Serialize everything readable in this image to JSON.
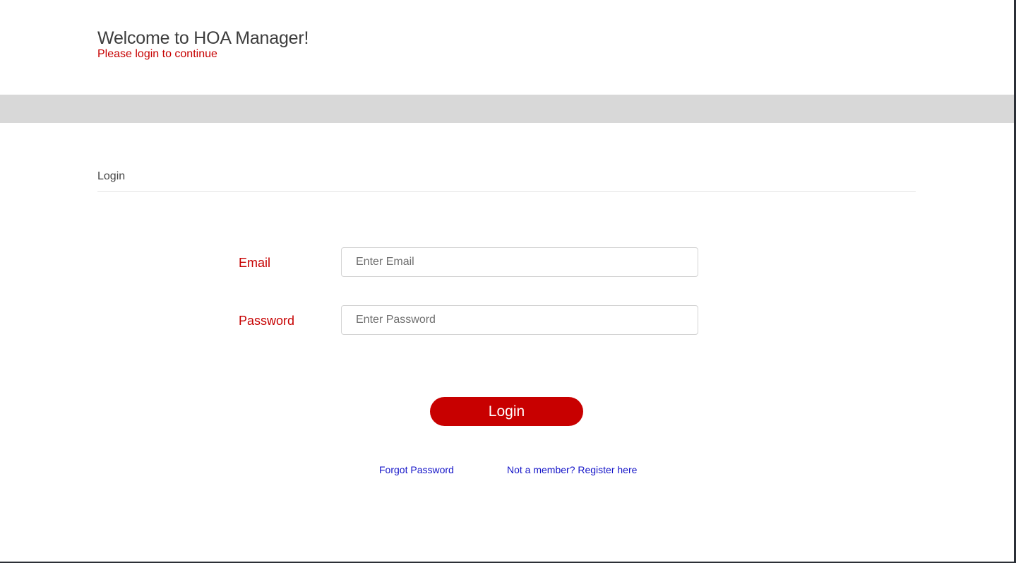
{
  "header": {
    "title": "Welcome to HOA Manager!",
    "subtitle": "Please login to continue"
  },
  "section": {
    "title": "Login"
  },
  "form": {
    "email_label": "Email",
    "email_placeholder": "Enter Email",
    "email_value": "",
    "password_label": "Password",
    "password_placeholder": "Enter Password",
    "password_value": "",
    "login_label": "Login"
  },
  "links": {
    "forgot_password": "Forgot Password",
    "register": "Not a member? Register here"
  },
  "colors": {
    "accent": "#c80000",
    "label": "#c60000",
    "link": "#1414c8",
    "band": "#d8d8d8"
  }
}
